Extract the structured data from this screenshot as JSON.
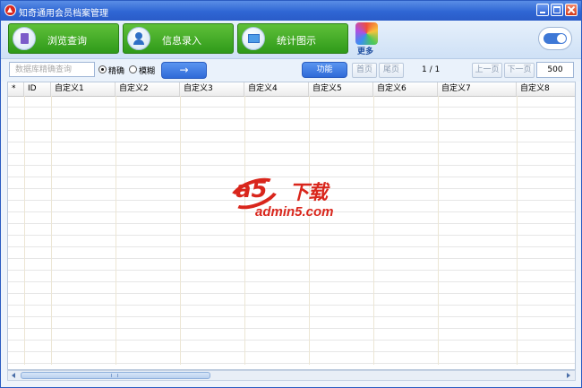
{
  "window": {
    "title": "知奇通用会员档案管理"
  },
  "toolbar": {
    "browse_label": "浏览查询",
    "entry_label": "信息录入",
    "stats_label": "统计图示",
    "more_label": "更多"
  },
  "search": {
    "placeholder": "数据库精确查询",
    "exact_label": "精确",
    "fuzzy_label": "模糊",
    "go_label": "→"
  },
  "actions": {
    "function_label": "功能"
  },
  "pager": {
    "first_label": "首页",
    "last_label": "尾页",
    "page_info": "1 / 1",
    "prev_label": "上一页",
    "next_label": "下一页",
    "page_size": "500"
  },
  "table": {
    "columns": [
      "*",
      "ID",
      "自定义1",
      "自定义2",
      "自定义3",
      "自定义4",
      "自定义5",
      "自定义6",
      "自定义7",
      "自定义8"
    ]
  },
  "watermark": {
    "logo": "a5",
    "title": "下载",
    "domain": "admin5.com"
  },
  "colors": {
    "titlebar": "#2f66d4",
    "nav_green": "#3aa622",
    "accent_blue": "#2f6ad8",
    "watermark_red": "#d9261c"
  }
}
